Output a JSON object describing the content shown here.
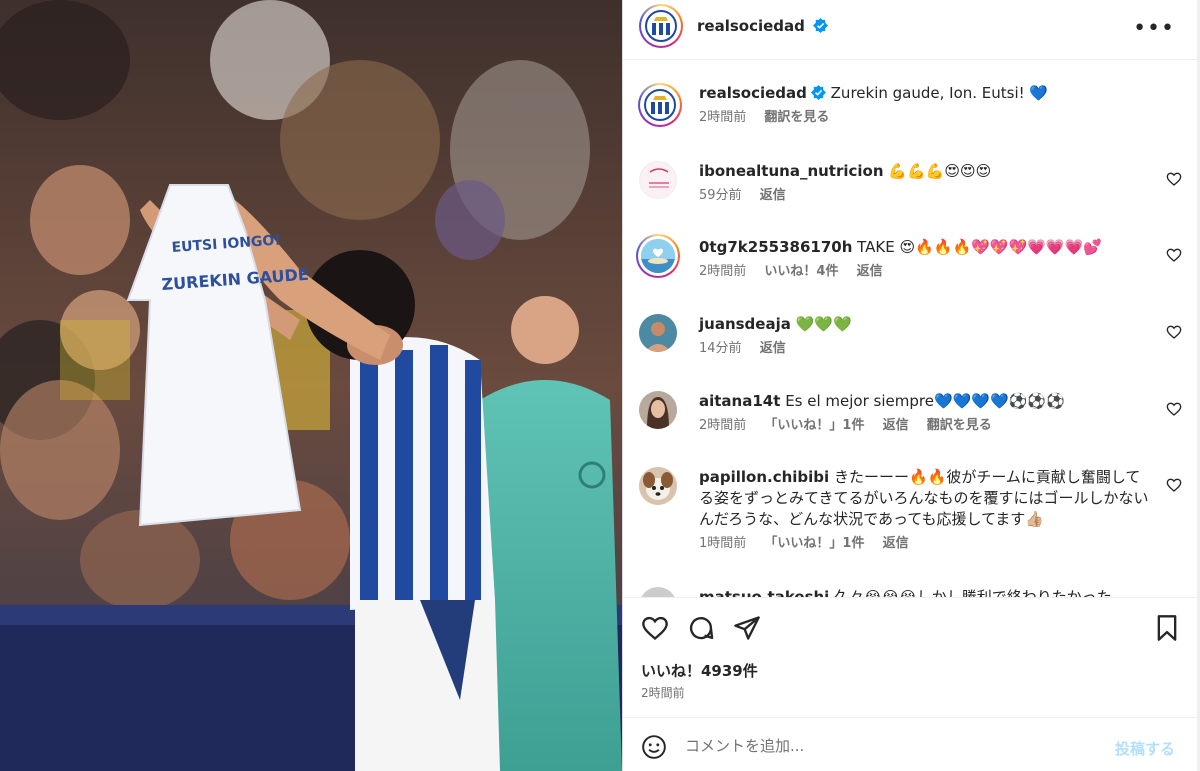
{
  "post": {
    "author": "realsociedad",
    "verified": true,
    "caption": {
      "user": "realsociedad",
      "text": "Zurekin gaude, Ion. Eutsi! 💙",
      "time": "2時間前",
      "translate": "翻訳を見る"
    },
    "photo": {
      "shirt_text_line1": "EUTSI IONGO!",
      "shirt_text_line2": "ZUREKIN GAUDE"
    }
  },
  "comments": [
    {
      "user": "ibonealtuna_nutricion",
      "text": "💪💪💪😍😍😍",
      "time": "59分前",
      "likes": "",
      "reply": "返信",
      "translate": "",
      "avatar_caption": "Ibone Altuna Nutricionista",
      "avatar_color": "#f3e6ea",
      "ring": false
    },
    {
      "user": "0tg7k255386170h",
      "text": "TAKE 😍🔥🔥🔥💖💖💖💗💗💗💕",
      "time": "2時間前",
      "likes": "いいね！4件",
      "reply": "返信",
      "translate": "",
      "avatar_color": "#7fc6e8",
      "ring": true
    },
    {
      "user": "juansdeaja",
      "text": "💚💚💚",
      "time": "14分前",
      "likes": "",
      "reply": "返信",
      "translate": "",
      "avatar_color": "#5a8fa8",
      "ring": false
    },
    {
      "user": "aitana14t",
      "text": "Es el mejor siempre💙💙💙💙⚽⚽⚽",
      "time": "2時間前",
      "likes": "「いいね！」1件",
      "reply": "返信",
      "translate": "翻訳を見る",
      "avatar_color": "#8a6d5a",
      "ring": false
    },
    {
      "user": "papillon.chibibi",
      "text": "きたーーー🔥🔥彼がチームに貢献し奮闘してる姿をずっとみてきてるがいろんなものを覆すにはゴールしかないんだろうな、どんな状況であっても応援してます👍🏼",
      "time": "1時間前",
      "likes": "「いいね！」1件",
      "reply": "返信",
      "translate": "",
      "avatar_color": "#c9a27a",
      "ring": false
    },
    {
      "user": "matsuo.takeshi",
      "text": "久々😭😭😭しかし勝利で終わりたかった",
      "time": "",
      "likes": "",
      "reply": "",
      "translate": "",
      "avatar_color": "#bbbbbb",
      "ring": false
    }
  ],
  "footer": {
    "likes": "いいね！4939件",
    "posted": "2時間前",
    "comment_placeholder": "コメントを追加...",
    "post_button": "投稿する"
  },
  "icons": {
    "more": "more-options-icon",
    "heart": "heart-icon",
    "comment": "comment-icon",
    "share": "share-icon",
    "save": "bookmark-icon",
    "emoji": "emoji-icon",
    "verified": "verified-badge-icon"
  },
  "colors": {
    "verified_blue": "#0095f6",
    "post_button_disabled": "#b2dffc",
    "club_blue": "#1f4aa0"
  }
}
